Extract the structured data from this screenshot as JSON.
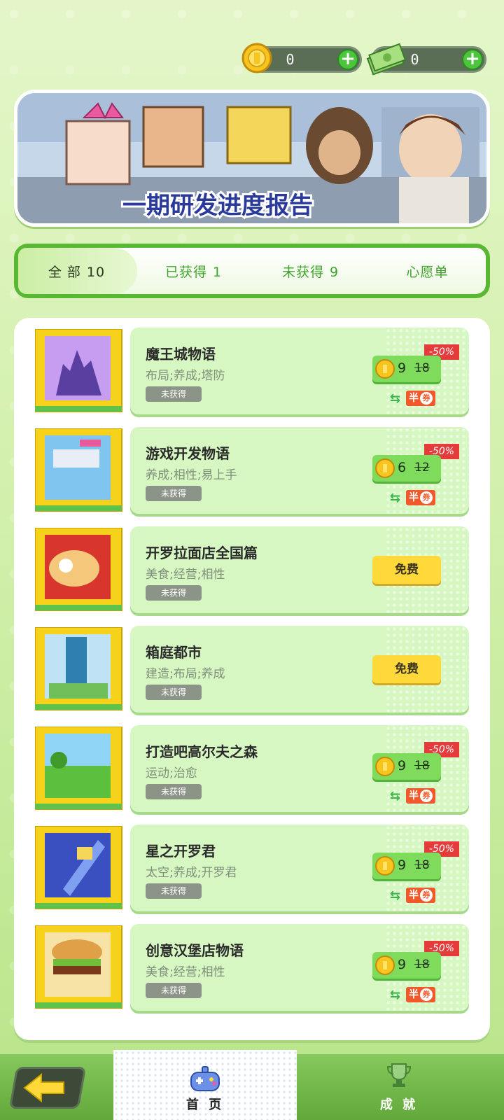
{
  "currencies": {
    "coins": {
      "value": "0",
      "icon": "gold-coin-icon"
    },
    "cash": {
      "value": "0",
      "icon": "cash-stack-icon"
    }
  },
  "banner": {
    "title": "一期研发进度报告"
  },
  "tabs": [
    {
      "label": "全 部",
      "count": "10",
      "active": true
    },
    {
      "label": "已获得",
      "count": "1",
      "active": false
    },
    {
      "label": "未获得",
      "count": "9",
      "active": false
    },
    {
      "label": "心愿单",
      "count": "",
      "active": false
    }
  ],
  "games": [
    {
      "title": "魔王城物语",
      "tags": "布局;养成;塔防",
      "status": "未获得",
      "price_type": "discount",
      "price": "9",
      "original_price": "18",
      "discount": "-50%",
      "half_label": "半"
    },
    {
      "title": "游戏开发物语",
      "tags": "养成;相性;易上手",
      "status": "未获得",
      "price_type": "discount",
      "price": "6",
      "original_price": "12",
      "discount": "-50%",
      "half_label": "半"
    },
    {
      "title": "开罗拉面店全国篇",
      "tags": "美食;经营;相性",
      "status": "未获得",
      "price_type": "free",
      "free_label": "免费"
    },
    {
      "title": "箱庭都市",
      "tags": "建造;布局;养成",
      "status": "未获得",
      "price_type": "free",
      "free_label": "免费"
    },
    {
      "title": "打造吧高尔夫之森",
      "tags": "运动;治愈",
      "status": "未获得",
      "price_type": "discount",
      "price": "9",
      "original_price": "18",
      "discount": "-50%",
      "half_label": "半"
    },
    {
      "title": "星之开罗君",
      "tags": "太空;养成;开罗君",
      "status": "未获得",
      "price_type": "discount",
      "price": "9",
      "original_price": "18",
      "discount": "-50%",
      "half_label": "半"
    },
    {
      "title": "创意汉堡店物语",
      "tags": "美食;经营;相性",
      "status": "未获得",
      "price_type": "discount",
      "price": "9",
      "original_price": "18",
      "discount": "-50%",
      "half_label": "半"
    }
  ],
  "bottom_nav": {
    "home_label": "首 页",
    "achievements_label": "成 就"
  },
  "colors": {
    "accent_green": "#59b734",
    "discount_red": "#e53b3b",
    "free_yellow": "#ffd93a"
  }
}
